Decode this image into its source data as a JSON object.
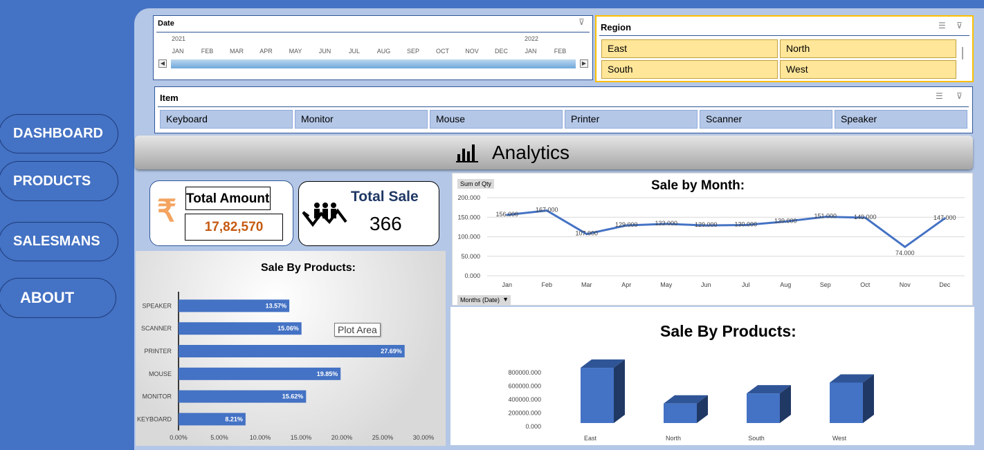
{
  "nav": {
    "dashboard": "DASHBOARD",
    "products": "PRODUCTS",
    "salesmans": "SALESMANS",
    "about": "ABOUT"
  },
  "date_slicer": {
    "title": "Date",
    "years": [
      "2021",
      "2022"
    ],
    "months": [
      "JAN",
      "FEB",
      "MAR",
      "APR",
      "MAY",
      "JUN",
      "JUL",
      "AUG",
      "SEP",
      "OCT",
      "NOV",
      "DEC",
      "JAN",
      "FEB"
    ]
  },
  "region_slicer": {
    "title": "Region",
    "items": [
      "East",
      "North",
      "South",
      "West"
    ]
  },
  "item_slicer": {
    "title": "Item",
    "items": [
      "Keyboard",
      "Monitor",
      "Mouse",
      "Printer",
      "Scanner",
      "Speaker"
    ]
  },
  "analytics": {
    "title": "Analytics"
  },
  "kpi": {
    "total_amount_label": "Total Amount",
    "total_amount_value": "17,82,570",
    "total_sale_label": "Total Sale",
    "total_sale_value": "366",
    "rupee_icon": "₹"
  },
  "colors": {
    "accent": "#4472c4",
    "slicer_selected": "#ffe699",
    "amount": "#c55a11"
  },
  "line_chart_tags": {
    "field": "Sum of Qty",
    "filter": "Months (Date)"
  },
  "tooltip": "Plot Area",
  "chart_data": [
    {
      "type": "bar",
      "title": "Sale By Products:",
      "orientation": "horizontal",
      "categories": [
        "SPEAKER",
        "SCANNER",
        "PRINTER",
        "MOUSE",
        "MONITOR",
        "KEYBOARD"
      ],
      "values": [
        13.57,
        15.06,
        27.69,
        19.85,
        15.62,
        8.21
      ],
      "data_labels": [
        "13.57%",
        "15.06%",
        "27.69%",
        "19.85%",
        "15.62%",
        "8.21%"
      ],
      "x_ticks": [
        "0.00%",
        "5.00%",
        "10.00%",
        "15.00%",
        "20.00%",
        "25.00%",
        "30.00%"
      ],
      "xlim": [
        0,
        30
      ],
      "grid": false
    },
    {
      "type": "line",
      "title": "Sale by Month:",
      "categories": [
        "Jan",
        "Feb",
        "Mar",
        "Apr",
        "May",
        "Jun",
        "Jul",
        "Aug",
        "Sep",
        "Oct",
        "Nov",
        "Dec"
      ],
      "values": [
        156,
        167,
        107,
        129,
        133,
        129,
        130,
        139,
        151,
        149,
        74,
        147
      ],
      "data_labels": [
        "156.000",
        "167.000",
        "107.000",
        "129.000",
        "133.000",
        "129.000",
        "130.000",
        "139.000",
        "151.000",
        "149.000",
        "74.000",
        "147.000"
      ],
      "y_ticks": [
        "0.000",
        "50.000",
        "100.000",
        "150.000",
        "200.000"
      ],
      "ylim": [
        0,
        200
      ],
      "grid": true
    },
    {
      "type": "bar",
      "title": "Sale By Products:",
      "style": "3d-column",
      "categories": [
        "East",
        "North",
        "South",
        "West"
      ],
      "values": [
        820000,
        290000,
        440000,
        600000
      ],
      "y_ticks": [
        "0.000",
        "200000.000",
        "400000.000",
        "600000.000",
        "800000.000"
      ],
      "ylim": [
        0,
        800000
      ],
      "grid": false
    }
  ]
}
